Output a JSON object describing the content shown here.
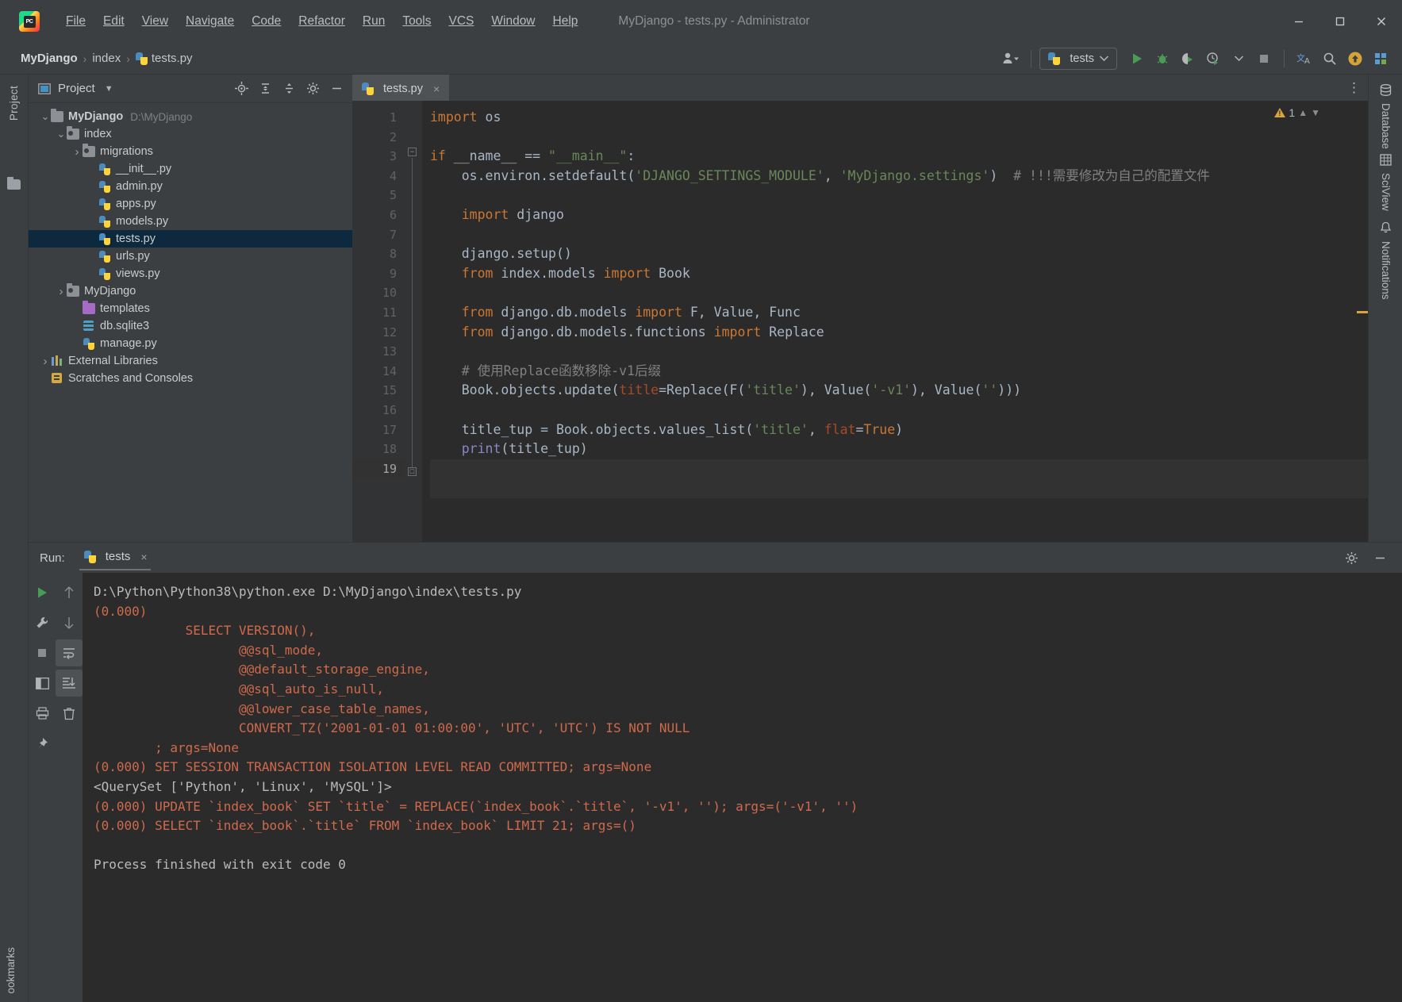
{
  "window": {
    "title": "MyDjango - tests.py - Administrator",
    "minimize_label": "Minimize",
    "maximize_label": "Maximize",
    "close_label": "Close"
  },
  "menu": {
    "items": [
      {
        "label": "File",
        "icon": "file-menu"
      },
      {
        "label": "Edit",
        "icon": "edit-menu"
      },
      {
        "label": "View",
        "icon": "view-menu"
      },
      {
        "label": "Navigate",
        "icon": "navigate-menu"
      },
      {
        "label": "Code",
        "icon": "code-menu"
      },
      {
        "label": "Refactor",
        "icon": "refactor-menu"
      },
      {
        "label": "Run",
        "icon": "run-menu"
      },
      {
        "label": "Tools",
        "icon": "tools-menu"
      },
      {
        "label": "VCS",
        "icon": "vcs-menu"
      },
      {
        "label": "Window",
        "icon": "window-menu"
      },
      {
        "label": "Help",
        "icon": "help-menu"
      }
    ]
  },
  "breadcrumb": {
    "project": "MyDjango",
    "folder": "index",
    "file": "tests.py",
    "separator": "›"
  },
  "toolbar": {
    "run_config": "tests",
    "icons": [
      "user-avatar-icon",
      "run-icon",
      "debug-icon",
      "coverage-icon",
      "profile-icon",
      "stop-icon",
      "translate-icon",
      "search-icon",
      "update-icon",
      "plugin-icon"
    ]
  },
  "left_strip": {
    "project_label": "Project",
    "bookmarks_label": "ookmarks"
  },
  "project_panel": {
    "title": "Project",
    "header_icons": [
      "locate-icon",
      "expand-all-icon",
      "collapse-all-icon",
      "gear-icon",
      "hide-icon"
    ],
    "tree": [
      {
        "label": "MyDjango",
        "path": "D:\\MyDjango",
        "indent": 0,
        "arrow": "down",
        "icon": "folder-root",
        "bold": true,
        "selected": false
      },
      {
        "label": "index",
        "path": "",
        "indent": 1,
        "arrow": "down",
        "icon": "folder-module",
        "bold": false,
        "selected": false
      },
      {
        "label": "migrations",
        "path": "",
        "indent": 2,
        "arrow": "right",
        "icon": "folder-module",
        "bold": false,
        "selected": false
      },
      {
        "label": "__init__.py",
        "path": "",
        "indent": 3,
        "arrow": "none",
        "icon": "python-file",
        "bold": false,
        "selected": false
      },
      {
        "label": "admin.py",
        "path": "",
        "indent": 3,
        "arrow": "none",
        "icon": "python-file",
        "bold": false,
        "selected": false
      },
      {
        "label": "apps.py",
        "path": "",
        "indent": 3,
        "arrow": "none",
        "icon": "python-file",
        "bold": false,
        "selected": false
      },
      {
        "label": "models.py",
        "path": "",
        "indent": 3,
        "arrow": "none",
        "icon": "python-file",
        "bold": false,
        "selected": false
      },
      {
        "label": "tests.py",
        "path": "",
        "indent": 3,
        "arrow": "none",
        "icon": "python-file",
        "bold": false,
        "selected": true
      },
      {
        "label": "urls.py",
        "path": "",
        "indent": 3,
        "arrow": "none",
        "icon": "python-file",
        "bold": false,
        "selected": false
      },
      {
        "label": "views.py",
        "path": "",
        "indent": 3,
        "arrow": "none",
        "icon": "python-file",
        "bold": false,
        "selected": false
      },
      {
        "label": "MyDjango",
        "path": "",
        "indent": 1,
        "arrow": "right",
        "icon": "folder-module",
        "bold": false,
        "selected": false
      },
      {
        "label": "templates",
        "path": "",
        "indent": 2,
        "arrow": "none",
        "icon": "folder-templates",
        "bold": false,
        "selected": false
      },
      {
        "label": "db.sqlite3",
        "path": "",
        "indent": 2,
        "arrow": "none",
        "icon": "database-file",
        "bold": false,
        "selected": false
      },
      {
        "label": "manage.py",
        "path": "",
        "indent": 2,
        "arrow": "none",
        "icon": "python-file",
        "bold": false,
        "selected": false
      },
      {
        "label": "External Libraries",
        "path": "",
        "indent": 0,
        "arrow": "right",
        "icon": "library",
        "bold": false,
        "selected": false
      },
      {
        "label": "Scratches and Consoles",
        "path": "",
        "indent": 0,
        "arrow": "none",
        "icon": "scratches",
        "bold": false,
        "selected": false
      }
    ]
  },
  "editor": {
    "tab_label": "tests.py",
    "tab_close": "×",
    "warning_count": "1",
    "options_icon": "more-options-icon",
    "lines": [
      {
        "n": "1",
        "run_marker": false,
        "current": false
      },
      {
        "n": "2",
        "run_marker": false,
        "current": false
      },
      {
        "n": "3",
        "run_marker": true,
        "current": false
      },
      {
        "n": "4",
        "run_marker": false,
        "current": false
      },
      {
        "n": "5",
        "run_marker": false,
        "current": false
      },
      {
        "n": "6",
        "run_marker": false,
        "current": false
      },
      {
        "n": "7",
        "run_marker": false,
        "current": false
      },
      {
        "n": "8",
        "run_marker": false,
        "current": false
      },
      {
        "n": "9",
        "run_marker": false,
        "current": false
      },
      {
        "n": "10",
        "run_marker": false,
        "current": false
      },
      {
        "n": "11",
        "run_marker": false,
        "current": false
      },
      {
        "n": "12",
        "run_marker": false,
        "current": false
      },
      {
        "n": "13",
        "run_marker": false,
        "current": false
      },
      {
        "n": "14",
        "run_marker": false,
        "current": false
      },
      {
        "n": "15",
        "run_marker": false,
        "current": false
      },
      {
        "n": "16",
        "run_marker": false,
        "current": false
      },
      {
        "n": "17",
        "run_marker": false,
        "current": false
      },
      {
        "n": "18",
        "run_marker": false,
        "current": false
      },
      {
        "n": "19",
        "run_marker": false,
        "current": true
      }
    ],
    "code_text": [
      "import os",
      "",
      "if __name__ == \"__main__\":",
      "    os.environ.setdefault('DJANGO_SETTINGS_MODULE', 'MyDjango.settings')  # !!!需要修改为自己的配置文件",
      "",
      "    import django",
      "",
      "    django.setup()",
      "    from index.models import Book",
      "",
      "    from django.db.models import F, Value, Func",
      "    from django.db.models.functions import Replace",
      "",
      "    # 使用Replace函数移除-v1后缀",
      "    Book.objects.update(title=Replace(F('title'), Value('-v1'), Value('')))",
      "",
      "    title_tup = Book.objects.values_list('title', flat=True)",
      "    print(title_tup)",
      ""
    ]
  },
  "right_strip": {
    "items": [
      {
        "label": "Database",
        "icon": "database-icon"
      },
      {
        "label": "SciView",
        "icon": "sciview-icon"
      },
      {
        "label": "Notifications",
        "icon": "notifications-icon"
      }
    ]
  },
  "run_panel": {
    "label": "Run:",
    "tab_label": "tests",
    "tab_close": "×",
    "settings_icon": "gear-icon",
    "hide_icon": "hide-icon",
    "sidebar_icons": [
      "rerun-icon",
      "wrench-icon",
      "stop-icon",
      "layout-icon",
      "print-icon",
      "pin-icon",
      "scroll-up-icon",
      "scroll-down-icon",
      "soft-wrap-icon",
      "scroll-to-end-icon",
      "trash-icon"
    ],
    "console": [
      {
        "text": "D:\\Python\\Python38\\python.exe D:\\MyDjango\\index\\tests.py",
        "color": "white"
      },
      {
        "text": "(0.000)",
        "color": "red"
      },
      {
        "text": "            SELECT VERSION(),",
        "color": "red"
      },
      {
        "text": "                   @@sql_mode,",
        "color": "red"
      },
      {
        "text": "                   @@default_storage_engine,",
        "color": "red"
      },
      {
        "text": "                   @@sql_auto_is_null,",
        "color": "red"
      },
      {
        "text": "                   @@lower_case_table_names,",
        "color": "red"
      },
      {
        "text": "                   CONVERT_TZ('2001-01-01 01:00:00', 'UTC', 'UTC') IS NOT NULL",
        "color": "red"
      },
      {
        "text": "        ; args=None",
        "color": "red"
      },
      {
        "text": "(0.000) SET SESSION TRANSACTION ISOLATION LEVEL READ COMMITTED; args=None",
        "color": "red"
      },
      {
        "text": "<QuerySet ['Python', 'Linux', 'MySQL']>",
        "color": "white"
      },
      {
        "text": "(0.000) UPDATE `index_book` SET `title` = REPLACE(`index_book`.`title`, '-v1', ''); args=('-v1', '')",
        "color": "red"
      },
      {
        "text": "(0.000) SELECT `index_book`.`title` FROM `index_book` LIMIT 21; args=()",
        "color": "red"
      },
      {
        "text": "",
        "color": "white"
      },
      {
        "text": "Process finished with exit code 0",
        "color": "white"
      }
    ]
  },
  "colors": {
    "accent_green": "#499c54",
    "warning_yellow": "#d9a343",
    "error_red": "#cf6a4c",
    "selection_blue": "#0d293e",
    "editor_bg": "#2b2b2b",
    "panel_bg": "#3c3f41"
  }
}
